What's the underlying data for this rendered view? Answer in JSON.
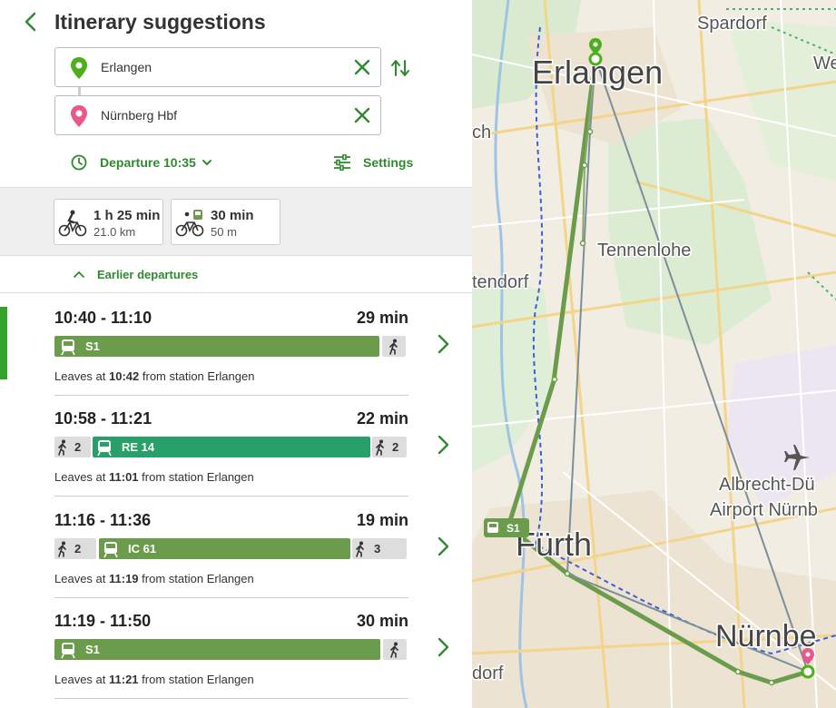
{
  "header": {
    "title": "Itinerary suggestions"
  },
  "from": {
    "value": "Erlangen"
  },
  "to": {
    "value": "Nürnberg Hbf"
  },
  "departure": {
    "label": "Departure 10:35"
  },
  "settings": {
    "label": "Settings"
  },
  "modes": [
    {
      "time": "1 h 25 min",
      "distance": "21.0 km"
    },
    {
      "time": "30 min",
      "distance": "50 m"
    }
  ],
  "earlier": {
    "label": "Earlier departures"
  },
  "trips": [
    {
      "time": "10:40 - 11:10",
      "duration": "29 min",
      "leaves_prefix": "Leaves at",
      "leaves_time": "10:42",
      "leaves_suffix": "from station Erlangen",
      "line": "S1"
    },
    {
      "time": "10:58 - 11:21",
      "duration": "22 min",
      "leaves_prefix": "Leaves at",
      "leaves_time": "11:01",
      "leaves_suffix": "from station Erlangen",
      "walk_before": "2",
      "line": "RE 14",
      "walk_after": "2"
    },
    {
      "time": "11:16 - 11:36",
      "duration": "19 min",
      "leaves_prefix": "Leaves at",
      "leaves_time": "11:19",
      "leaves_suffix": "from station Erlangen",
      "walk_before": "2",
      "line": "IC 61",
      "walk_after": "3"
    },
    {
      "time": "11:19 - 11:50",
      "duration": "30 min",
      "leaves_prefix": "Leaves at",
      "leaves_time": "11:21",
      "leaves_suffix": "from station Erlangen",
      "line": "S1"
    }
  ],
  "map": {
    "labels": {
      "erlangen": "Erlangen",
      "spardorf": "Spardorf",
      "we": "We",
      "ch": "ch",
      "tennenlohe": "Tennenlohe",
      "tendorf": "tendorf",
      "albrecht": "Albrecht-Dü",
      "airport": "Airport Nürnb",
      "furth": "Fürth",
      "nurnberg": "Nürnbe",
      "dorf": "dorf"
    },
    "route_badge": "S1"
  },
  "colors": {
    "accent": "#2f8a2f",
    "s1": "#6b9c4b",
    "re": "#28a06a",
    "origin_pin": "#4caf1b",
    "dest_pin": "#e8588a"
  }
}
